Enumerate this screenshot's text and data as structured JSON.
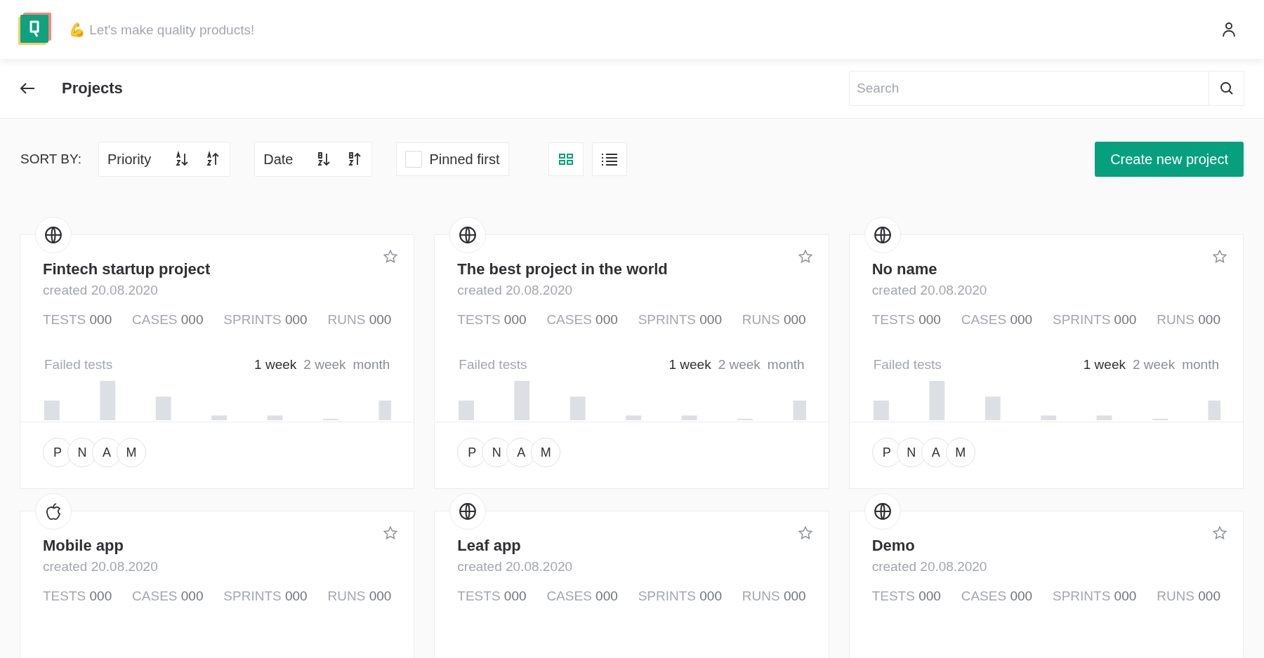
{
  "header": {
    "slogan_emoji": "💪",
    "slogan": "Let's make quality products!"
  },
  "page": {
    "title": "Projects",
    "search": {
      "placeholder": "Search"
    }
  },
  "toolbar": {
    "sort_label": "SORT BY:",
    "sorts": [
      {
        "label": "Priority",
        "kind": "alpha"
      },
      {
        "label": "Date",
        "kind": "numeric"
      }
    ],
    "pinned_first": {
      "label": "Pinned first",
      "checked": false
    },
    "views": [
      {
        "kind": "grid",
        "selected": true
      },
      {
        "kind": "list",
        "selected": false
      }
    ],
    "create_button": "Create new project"
  },
  "projects": [
    {
      "name": "Fintech startup project",
      "kind": "globe",
      "starred": false,
      "created_label": "created",
      "created": "20.08.2020",
      "stats": [
        {
          "label": "TESTS",
          "value": "000"
        },
        {
          "label": "CASES",
          "value": "000"
        },
        {
          "label": "SPRINTS",
          "value": "000"
        },
        {
          "label": "RUNS",
          "value": "000"
        }
      ],
      "chart_title": "Failed tests",
      "periods": [
        {
          "label": "1 week",
          "selected": true
        },
        {
          "label": "2 week",
          "selected": false
        },
        {
          "label": "month",
          "selected": false
        }
      ],
      "members": [
        "P",
        "N",
        "A",
        "M"
      ]
    },
    {
      "name": "The best project in the world",
      "kind": "globe",
      "starred": false,
      "created_label": "created",
      "created": "20.08.2020",
      "stats": [
        {
          "label": "TESTS",
          "value": "000"
        },
        {
          "label": "CASES",
          "value": "000"
        },
        {
          "label": "SPRINTS",
          "value": "000"
        },
        {
          "label": "RUNS",
          "value": "000"
        }
      ],
      "chart_title": "Failed tests",
      "periods": [
        {
          "label": "1 week",
          "selected": true
        },
        {
          "label": "2 week",
          "selected": false
        },
        {
          "label": "month",
          "selected": false
        }
      ],
      "members": [
        "P",
        "N",
        "A",
        "M"
      ]
    },
    {
      "name": "No name",
      "kind": "globe",
      "starred": false,
      "created_label": "created",
      "created": "20.08.2020",
      "stats": [
        {
          "label": "TESTS",
          "value": "000"
        },
        {
          "label": "CASES",
          "value": "000"
        },
        {
          "label": "SPRINTS",
          "value": "000"
        },
        {
          "label": "RUNS",
          "value": "000"
        }
      ],
      "chart_title": "Failed tests",
      "periods": [
        {
          "label": "1 week",
          "selected": true
        },
        {
          "label": "2 week",
          "selected": false
        },
        {
          "label": "month",
          "selected": false
        }
      ],
      "members": [
        "P",
        "N",
        "A",
        "M"
      ]
    },
    {
      "name": "Mobile app",
      "kind": "apple",
      "starred": false,
      "created_label": "created",
      "created": "20.08.2020",
      "stats": [
        {
          "label": "TESTS",
          "value": "000"
        },
        {
          "label": "CASES",
          "value": "000"
        },
        {
          "label": "SPRINTS",
          "value": "000"
        },
        {
          "label": "RUNS",
          "value": "000"
        }
      ]
    },
    {
      "name": "Leaf app",
      "kind": "globe",
      "starred": false,
      "created_label": "created",
      "created": "20.08.2020",
      "stats": [
        {
          "label": "TESTS",
          "value": "000"
        },
        {
          "label": "CASES",
          "value": "000"
        },
        {
          "label": "SPRINTS",
          "value": "000"
        },
        {
          "label": "RUNS",
          "value": "000"
        }
      ]
    },
    {
      "name": "Demo",
      "kind": "globe",
      "starred": false,
      "created_label": "created",
      "created": "20.08.2020",
      "stats": [
        {
          "label": "TESTS",
          "value": "000"
        },
        {
          "label": "CASES",
          "value": "000"
        },
        {
          "label": "SPRINTS",
          "value": "000"
        },
        {
          "label": "RUNS",
          "value": "000"
        }
      ]
    }
  ]
}
